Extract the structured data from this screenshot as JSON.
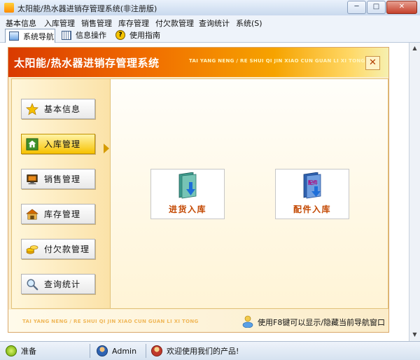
{
  "window": {
    "title": "太阳能/热水器进销存管理系统(非注册版)",
    "minimize_glyph": "─",
    "maximize_glyph": "□",
    "close_glyph": "✕"
  },
  "menu": [
    {
      "label": "基本信息"
    },
    {
      "label": "入库管理"
    },
    {
      "label": "销售管理"
    },
    {
      "label": "库存管理"
    },
    {
      "label": "付欠款管理"
    },
    {
      "label": "查询统计"
    },
    {
      "label": "系统(S)"
    }
  ],
  "toolbar": [
    {
      "label": "系统导航",
      "icon": "window-icon",
      "active": true
    },
    {
      "label": "信息操作",
      "icon": "grid-icon",
      "active": false
    },
    {
      "label": "使用指南",
      "icon": "help-icon",
      "help_glyph": "?",
      "active": false
    }
  ],
  "panel": {
    "title": "太阳能/热水器进销存管理系统",
    "subtitle": "TAI YANG NENG / RE SHUI QI JIN XIAO CUN GUAN LI XI TONG",
    "close_glyph": "✕",
    "footer_text": "TAI YANG NENG / RE SHUI QI JIN XIAO CUN GUAN LI XI TONG",
    "hint": "使用F8键可以显示/隐藏当前导航窗口"
  },
  "nav": [
    {
      "label": "基本信息",
      "icon": "star-icon"
    },
    {
      "label": "入库管理",
      "icon": "house-icon",
      "active": true
    },
    {
      "label": "销售管理",
      "icon": "monitor-icon"
    },
    {
      "label": "库存管理",
      "icon": "warehouse-icon"
    },
    {
      "label": "付欠款管理",
      "icon": "coins-icon"
    },
    {
      "label": "查询统计",
      "icon": "magnifier-icon"
    }
  ],
  "actions": [
    {
      "label": "进货入库",
      "icon": "folder-download-icon"
    },
    {
      "label": "配件入库",
      "icon": "parts-folder-icon",
      "icon_text": "配件"
    }
  ],
  "status": [
    {
      "label": "准备",
      "icon": "ready-icon"
    },
    {
      "label": "Admin",
      "icon": "user-icon"
    },
    {
      "label": "欢迎使用我们的产品!",
      "icon": "person-icon"
    }
  ],
  "colors": {
    "header_start": "#d93a00",
    "header_end": "#f6f0b0",
    "action_text": "#c34700",
    "active_nav": "#f7c200"
  }
}
